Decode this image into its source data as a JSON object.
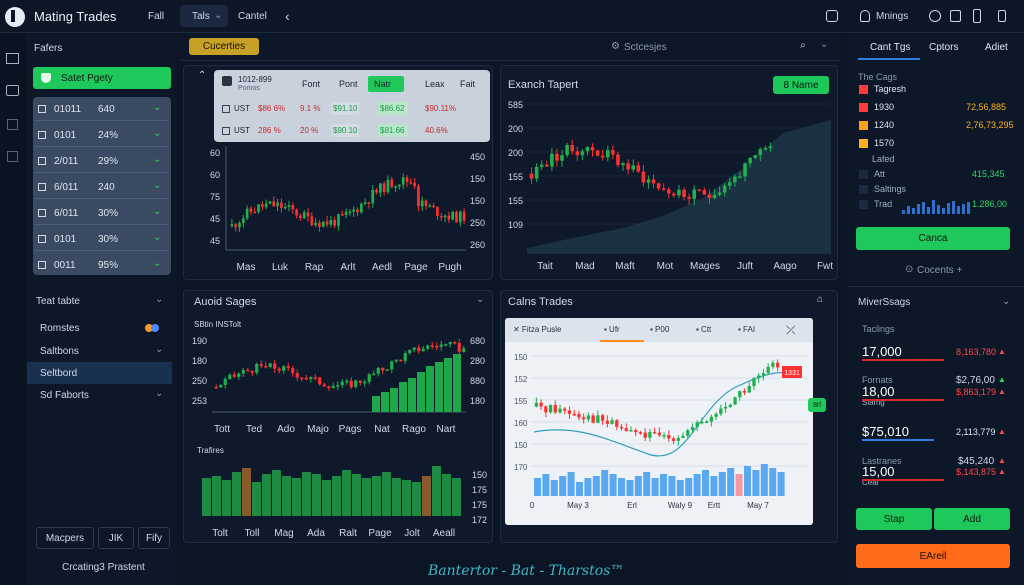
{
  "app": {
    "title": "Mating Trades"
  },
  "topbar": {
    "tabs": [
      "Fall",
      "Tals",
      "Cantel"
    ],
    "right_label": "Mnings",
    "chevron": "‹"
  },
  "sidebar": {
    "title": "Fafers",
    "primary_button": "Satet Pgety",
    "rows": [
      {
        "id": "01011",
        "val": "640"
      },
      {
        "id": "0101",
        "val": "24%"
      },
      {
        "id": "2/011",
        "val": "29%"
      },
      {
        "id": "6/011",
        "val": "240"
      },
      {
        "id": "6/011",
        "val": "30%"
      },
      {
        "id": "0101",
        "val": "30%"
      },
      {
        "id": "0011",
        "val": "95%"
      }
    ],
    "section_title": "Teat tabte",
    "nav": [
      "Romstes",
      "Saltbons",
      "Seltbord",
      "Sd Faborts"
    ],
    "bottom_buttons": [
      "Macpers",
      "JIK",
      "Fify"
    ],
    "footer": "Crcating3 Prastent"
  },
  "toolbar": {
    "chip": "Cucerties",
    "search": "Sctcesjes"
  },
  "ticker": {
    "header": [
      "Font",
      "Pont",
      "Natr",
      "Leax",
      "Fait"
    ],
    "logo_name": "1012-899",
    "logo_sub": "Pomos",
    "rows": [
      {
        "name": "UST",
        "cells": [
          "$86 6%",
          "9.1 %",
          "$91.10",
          "$86.62",
          "$90.11%"
        ]
      },
      {
        "name": "UST",
        "cells": [
          "286 %",
          "20 %",
          "$90.10",
          "$81.66",
          "40.6%"
        ]
      }
    ]
  },
  "chart1": {
    "y_left": [
      "60",
      "60",
      "75",
      "45",
      "45"
    ],
    "y_right": [
      "450",
      "150",
      "150",
      "250",
      "260"
    ],
    "x_labels": [
      "Mas",
      "Luk",
      "Rap",
      "Arlt",
      "Aedl",
      "Page",
      "Pugh"
    ]
  },
  "chart2": {
    "title": "Exanch Tapert",
    "button": "8 Name",
    "y_labels": [
      "585",
      "200",
      "200",
      "155",
      "155",
      "109"
    ],
    "x_labels": [
      "Tait",
      "Mad",
      "Maft",
      "Mot",
      "Mages",
      "Juft",
      "Aago",
      "Fwt"
    ]
  },
  "chart3": {
    "title": "Auoid Sages",
    "subtitle": "SBtin INSTolt",
    "y_left": [
      "190",
      "180",
      "250",
      "253"
    ],
    "y_right": [
      "680",
      "280",
      "880",
      "180"
    ],
    "x_labels": [
      "Tott",
      "Ted",
      "Ado",
      "Majo",
      "Pags",
      "Nat",
      "Rago",
      "Nart"
    ],
    "vol_title": "Trafires",
    "vol_right": [
      "150",
      "175",
      "175",
      "172"
    ],
    "vol_x": [
      "Tolt",
      "Toll",
      "Mag",
      "Ada",
      "Ralt",
      "Page",
      "Jolt",
      "Aeall"
    ]
  },
  "chart4": {
    "title": "Calns Trades",
    "tabs": [
      "Fitza Pusle",
      "Ufr",
      "P00",
      "Ctt",
      "FAI"
    ],
    "y_labels": [
      "150",
      "152",
      "155",
      "160",
      "150",
      "170"
    ],
    "x_labels": [
      "0",
      "May 3",
      "Erl",
      "Waly 9",
      "Ertt",
      "May 7"
    ],
    "price_tag": "1331",
    "side_tag": "8rl"
  },
  "right": {
    "tabs": [
      "Cant Tgs",
      "Cptors",
      "Adiet"
    ],
    "list_title": "The Cags",
    "legend": [
      {
        "label": "Tagresh",
        "val": "",
        "color": "#ff3b3b"
      },
      {
        "label": "1930",
        "val": "72,56,885",
        "color": "#ff3b3b"
      },
      {
        "label": "1240",
        "val": "2,76,73,295",
        "color": "#ff9f1a"
      },
      {
        "label": "1570",
        "val": "",
        "color": "#ffb020"
      }
    ],
    "lines": [
      {
        "label": "Lafed",
        "val": ""
      },
      {
        "label": "Att",
        "val": "415,345"
      },
      {
        "label": "Saltings",
        "val": ""
      },
      {
        "label": "Trad",
        "val": "1.286,00"
      }
    ],
    "green_button": "Canca",
    "link": "Cocents +",
    "section2": "MiverSsags",
    "s2_label1": "Taclings",
    "stats": [
      {
        "big": "17,000",
        "sub": "",
        "val": "8,163,780"
      },
      {
        "big": "18,00",
        "sub": "Slamg",
        "val": "$,863,179"
      },
      {
        "big": "$75,010",
        "sub": "",
        "val": "2,113,779"
      },
      {
        "big": "15,00",
        "sub": "Ceal",
        "val": "$,143,875"
      }
    ],
    "stat_labels": [
      "Fornats",
      "Lastranes"
    ],
    "s2_vals_mid": [
      "$2,76,00"
    ],
    "mid_val2": "$45,240",
    "stop_button": "Stap",
    "add_button": "Add",
    "orange_button": "EAreil"
  },
  "footer_brand": "Bantertor - Bat - Tharstos™",
  "colors": {
    "green": "#2fd66b",
    "red": "#ff3b3b",
    "accent": "#1fc85b",
    "orange": "#ff6a1a"
  }
}
